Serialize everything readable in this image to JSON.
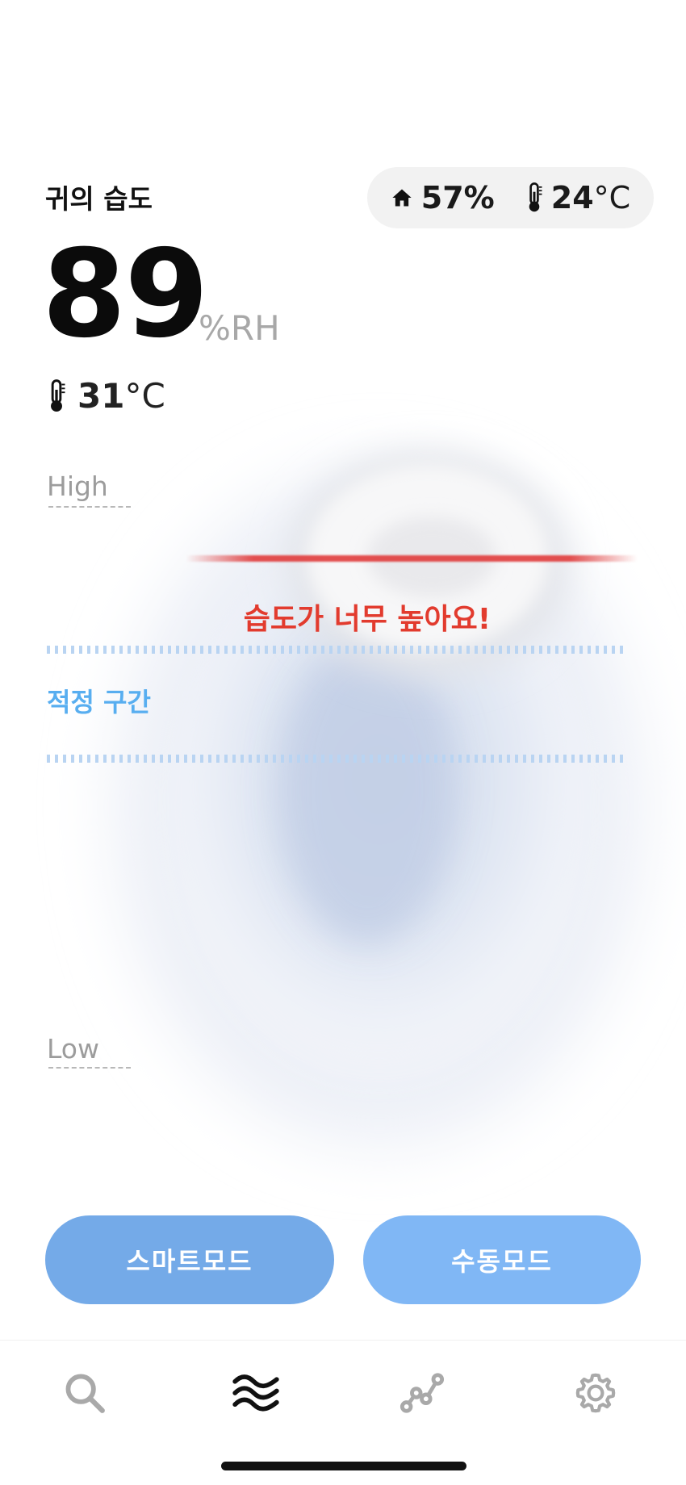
{
  "header": {
    "title": "귀의 습도",
    "ambient_humidity": "57%",
    "ambient_temp_number": "24",
    "ambient_temp_unit": "°C"
  },
  "reading": {
    "humidity_value": "89",
    "humidity_unit": "%RH",
    "ear_temp_number": "31",
    "ear_temp_unit": "°C"
  },
  "gauge": {
    "high_label": "High",
    "low_label": "Low",
    "warning_text": "습도가 너무 높아요!",
    "optimal_zone_label": "적정 구간"
  },
  "modes": {
    "smart_label": "스마트모드",
    "manual_label": "수동모드"
  },
  "tabs": [
    {
      "icon": "search-icon"
    },
    {
      "icon": "waves-icon",
      "active": true
    },
    {
      "icon": "graph-icon"
    },
    {
      "icon": "gear-icon"
    }
  ],
  "colors": {
    "warning": "#e23b2e",
    "optimal": "#58aef0",
    "button_smart": "#74aae8",
    "button_manual": "#80b7f5"
  }
}
